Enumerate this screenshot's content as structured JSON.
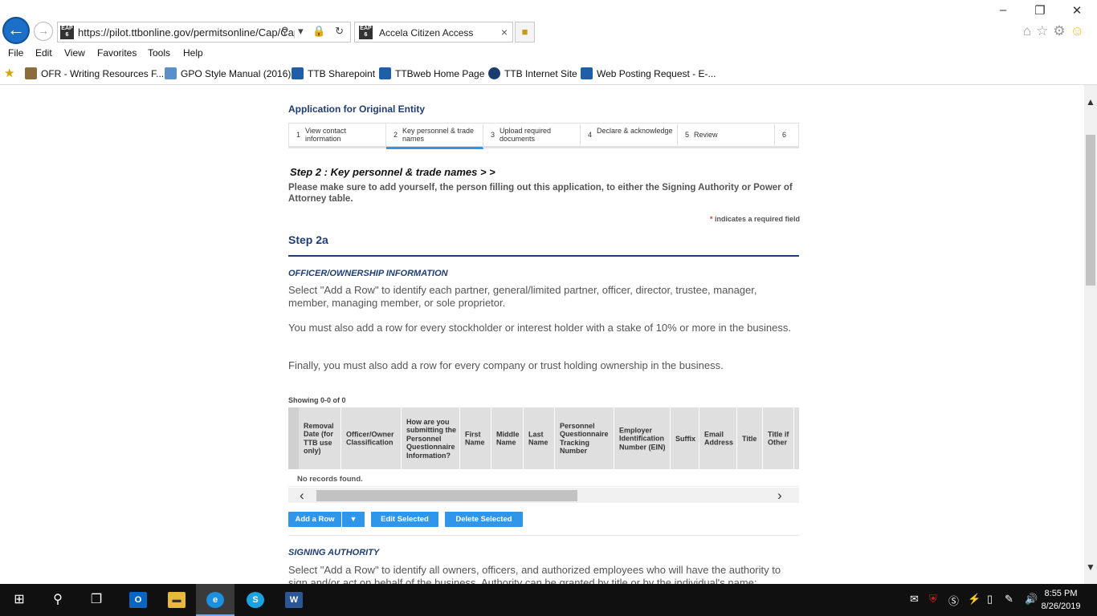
{
  "browser": {
    "url": "https://pilot.ttbonline.gov/permitsonline/Cap/Cap",
    "tab_title": "Accela Citizen Access",
    "favicon_text": "EAP 6",
    "close_glyph": "×",
    "address_controls": "⚲ ▾ 🔒 ↻",
    "tool_icons": [
      "⌂",
      "☆",
      "⚙",
      "☺"
    ],
    "window_controls": [
      "–",
      "❐",
      "✕"
    ],
    "menu": [
      "File",
      "Edit",
      "View",
      "Favorites",
      "Tools",
      "Help"
    ],
    "favorites": [
      {
        "label": "OFR - Writing Resources F...",
        "color": "#8a6d3b"
      },
      {
        "label": "GPO Style Manual (2016)",
        "color": "#5b8fc9"
      },
      {
        "label": "TTB Sharepoint",
        "color": "#1f5fa8"
      },
      {
        "label": "TTBweb Home Page",
        "color": "#1f5fa8"
      },
      {
        "label": "TTB Internet Site",
        "color": "#1d3c6e"
      },
      {
        "label": "Web Posting Request - E-...",
        "color": "#1f5fa8"
      }
    ]
  },
  "page": {
    "app_title": "Application for Original Entity",
    "steps": [
      {
        "num": "1",
        "label": "View contact information",
        "active": false
      },
      {
        "num": "2",
        "label": "Key personnel & trade names",
        "active": true
      },
      {
        "num": "3",
        "label": "Upload required documents",
        "active": false
      },
      {
        "num": "4",
        "label": "Declare & acknowledge",
        "active": false
      },
      {
        "num": "5",
        "label": "Review",
        "active": false
      },
      {
        "num": "6",
        "label": "",
        "active": false
      }
    ],
    "step_heading": "Step 2 : Key personnel & trade names > >",
    "intro": "Please make sure to add yourself, the person filling out this application, to either the Signing Authority or Power of Attorney table.",
    "required_star": "*",
    "required_note": "indicates a required field",
    "section_title": "Step 2a",
    "officer": {
      "title": "OFFICER/OWNERSHIP INFORMATION",
      "paragraphs": [
        "Select \"Add a Row\" to identify each partner, general/limited partner, officer, director, trustee, manager, member, managing member, or sole proprietor.",
        "You must also add a row for every stockholder or interest holder with a stake of 10% or more in the business.",
        "Finally, you must also add a row for every company or trust holding ownership in the business."
      ],
      "showing": "Showing 0-0 of 0",
      "columns": [
        "Removal Date (for TTB use only)",
        "Officer/Owner Classification",
        "How are you submitting the Personnel Questionnaire Information?",
        "First Name",
        "Middle Name",
        "Last Name",
        "Personnel Questionnaire Tracking Number",
        "Employer Identification Number (EIN)",
        "Suffix",
        "Email Address",
        "Title",
        "Title if Other"
      ],
      "no_records": "No records found.",
      "buttons": {
        "add_row": "Add a Row",
        "caret": "▼",
        "edit": "Edit Selected",
        "delete": "Delete Selected"
      }
    },
    "signing": {
      "title": "SIGNING AUTHORITY",
      "paragraph": "Select \"Add a Row\" to identify all owners, officers, and authorized employees who will have the authority to sign and/or act on behalf of the business. Authority can be granted by title or by the individual's name;"
    }
  },
  "taskbar": {
    "apps": [
      "Outlook",
      "File Explorer",
      "Internet Explorer",
      "Skype",
      "Word"
    ],
    "time": "8:55 PM",
    "date": "8/26/2019"
  }
}
